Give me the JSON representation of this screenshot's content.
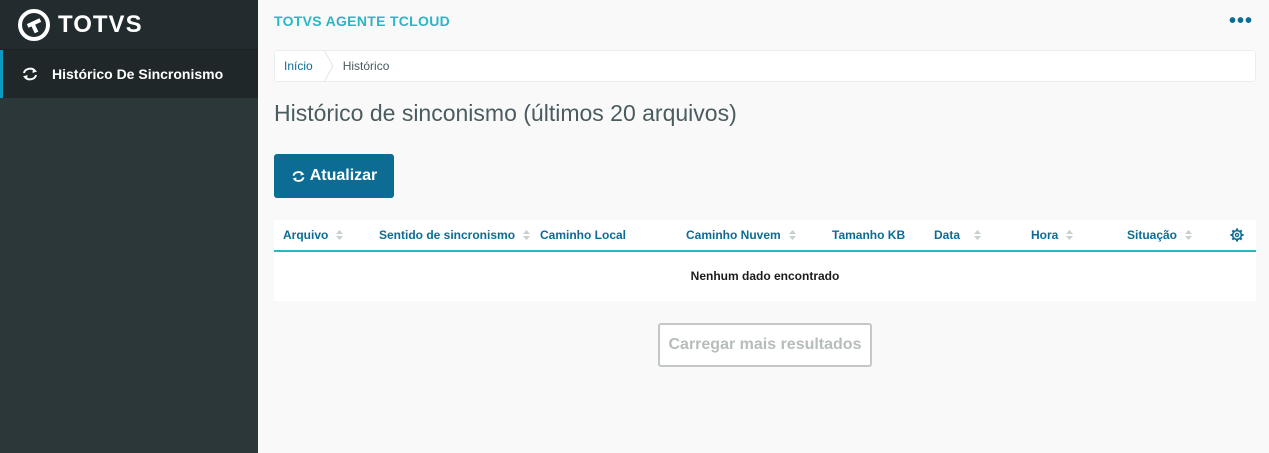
{
  "sidebar": {
    "logo_text": "TOTVS",
    "items": [
      {
        "label": "Histórico De Sincronismo",
        "icon": "sync-icon",
        "active": true
      }
    ]
  },
  "header": {
    "app_title": "TOTVS AGENTE TCLOUD",
    "more_icon": "more-horizontal-icon"
  },
  "breadcrumb": {
    "home": "Início",
    "current": "Histórico"
  },
  "main": {
    "title": "Histórico de sinconismo (últimos 20 arquivos)",
    "refresh_label": "Atualizar",
    "table": {
      "columns": [
        "Arquivo",
        "Sentido de sincronismo",
        "Caminho Local",
        "Caminho Nuvem",
        "Tamanho KB",
        "Data",
        "Hora",
        "Situação"
      ],
      "empty_message": "Nenhum dado encontrado"
    },
    "load_more_label": "Carregar mais resultados"
  },
  "colors": {
    "sidebar_bg": "#2c3739",
    "accent": "#29b6c5",
    "primary": "#0c6c94",
    "active_border": "#0c9abe"
  }
}
